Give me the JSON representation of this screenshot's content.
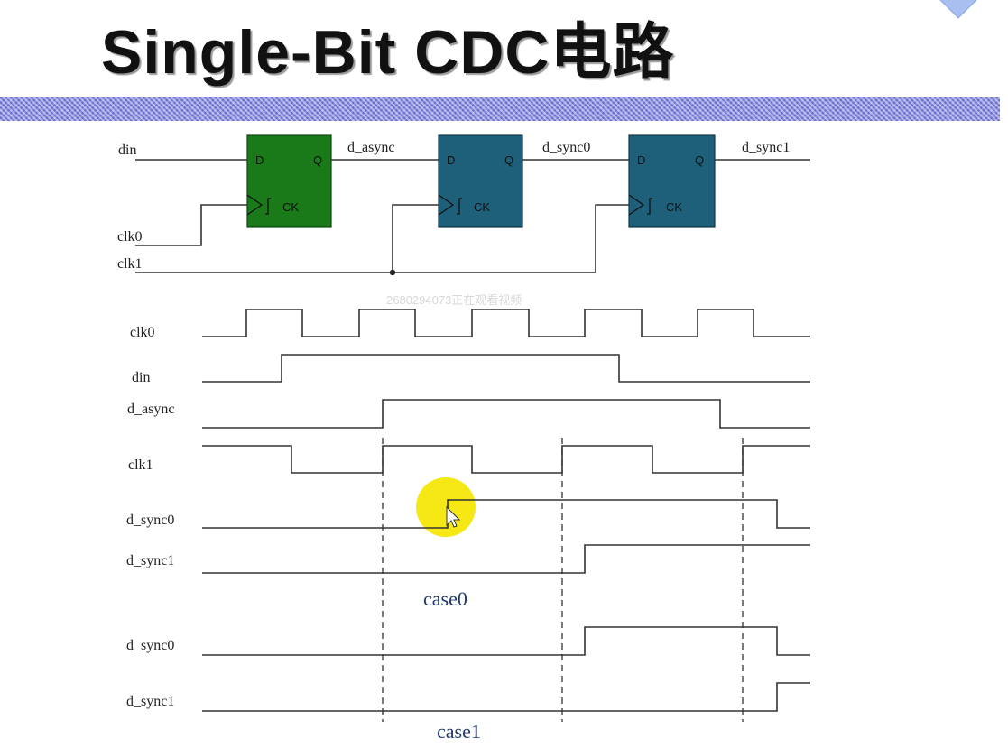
{
  "title": "Single-Bit CDC电路",
  "watermark": "2680294073正在观看视频",
  "colors": {
    "title_bar": "#8a8fe6",
    "ff_first": "#1a7a1a",
    "ff_sync": "#1e5f7a",
    "highlight": "#f5e600",
    "case_label": "#1f3a6b"
  },
  "schematic": {
    "inputs": [
      "din",
      "clk0",
      "clk1"
    ],
    "nets": [
      "d_async",
      "d_sync0",
      "d_sync1"
    ],
    "flipflops": [
      {
        "d": "D",
        "q": "Q",
        "ck": "CK",
        "clock": "clk0"
      },
      {
        "d": "D",
        "q": "Q",
        "ck": "CK",
        "clock": "clk1"
      },
      {
        "d": "D",
        "q": "Q",
        "ck": "CK",
        "clock": "clk1"
      }
    ]
  },
  "timing": {
    "signals": [
      "clk0",
      "din",
      "d_async",
      "clk1",
      "d_sync0",
      "d_sync1"
    ],
    "case0_label": "case0",
    "case1_signals": [
      "d_sync0",
      "d_sync1"
    ],
    "case1_label": "case1"
  },
  "cursor": "pointer-icon"
}
